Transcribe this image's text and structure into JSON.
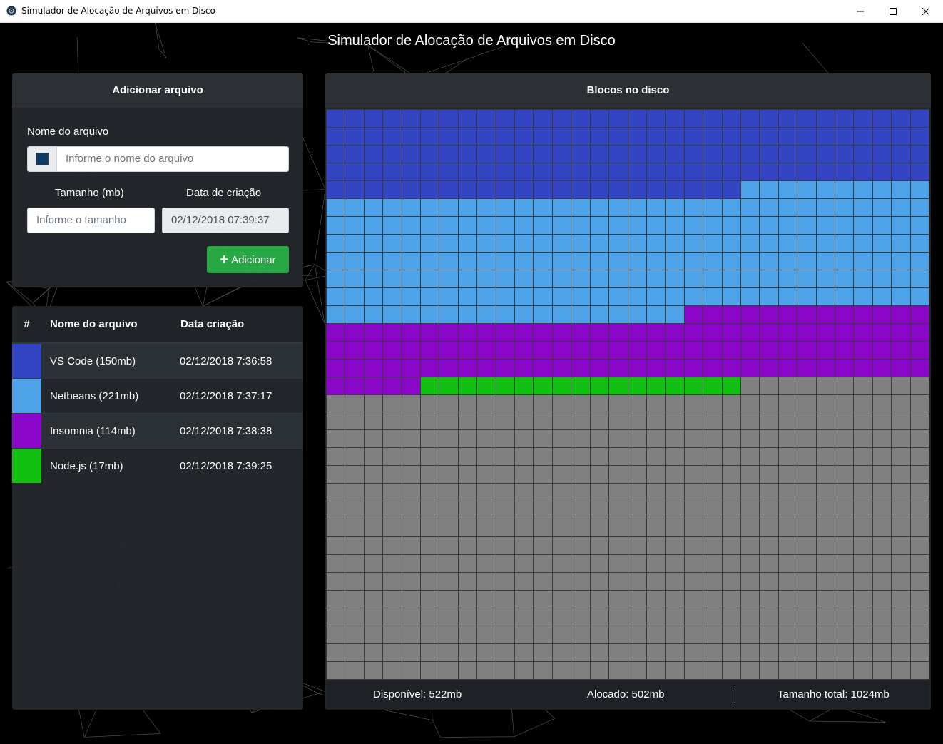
{
  "window": {
    "title": "Simulador de Alocação de Arquivos em Disco"
  },
  "app": {
    "title": "Simulador de Alocação de Arquivos em Disco"
  },
  "add_panel": {
    "header": "Adicionar arquivo",
    "name_label": "Nome do arquivo",
    "name_placeholder": "Informe o nome do arquivo",
    "size_label": "Tamanho (mb)",
    "size_placeholder": "Informe o tamanho",
    "date_label": "Data de criação",
    "date_value": "02/12/2018 07:39:37",
    "add_button": "Adicionar",
    "selected_color": "#0d3b66"
  },
  "files_table": {
    "columns": [
      "#",
      "Nome do arquivo",
      "Data criação"
    ],
    "rows": [
      {
        "color": "#3445c4",
        "name": "VS Code (150mb)",
        "date": "02/12/2018 7:36:58",
        "size_mb": 150
      },
      {
        "color": "#4fa3e8",
        "name": "Netbeans (221mb)",
        "date": "02/12/2018 7:37:17",
        "size_mb": 221
      },
      {
        "color": "#8a06c9",
        "name": "Insomnia (114mb)",
        "date": "02/12/2018 7:38:38",
        "size_mb": 114
      },
      {
        "color": "#12c012",
        "name": "Node.js (17mb)",
        "date": "02/12/2018 7:39:25",
        "size_mb": 17
      }
    ]
  },
  "disk": {
    "header": "Blocos no disco",
    "free_color": "#808080",
    "total_blocks": 1024,
    "available": "Disponível: 522mb",
    "allocated": "Alocado: 502mb",
    "total": "Tamanho total: 1024mb"
  }
}
